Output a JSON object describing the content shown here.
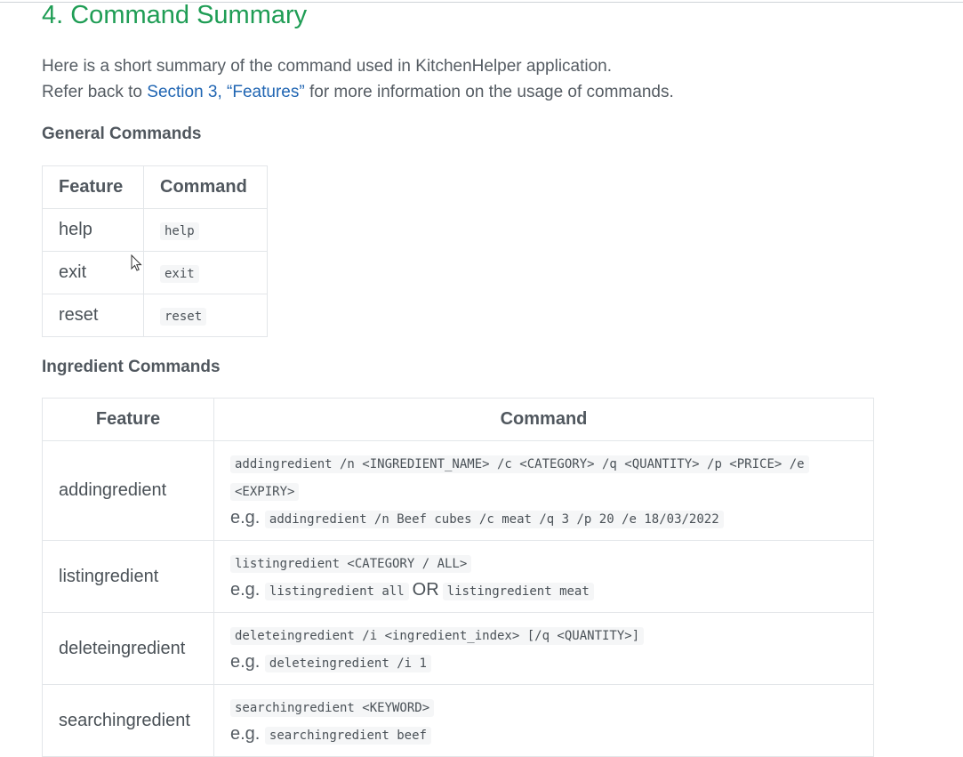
{
  "heading": "4. Command Summary",
  "intro": {
    "line1": "Here is a short summary of the command used in KitchenHelper application.",
    "line2_prefix": "Refer back to ",
    "link": "Section 3, “Features”",
    "line2_suffix": " for more information on the usage of commands."
  },
  "general": {
    "heading": "General Commands",
    "headers": {
      "feature": "Feature",
      "command": "Command"
    },
    "rows": [
      {
        "feature": "help",
        "command": "help"
      },
      {
        "feature": "exit",
        "command": "exit"
      },
      {
        "feature": "reset",
        "command": "reset"
      }
    ]
  },
  "ingredient": {
    "heading": "Ingredient Commands",
    "headers": {
      "feature": "Feature",
      "command": "Command"
    },
    "eg": "e.g.",
    "or": "OR",
    "rows": [
      {
        "feature": "addingredient",
        "syntax1": "addingredient /n <INGREDIENT_NAME> /c <CATEGORY> /q <QUANTITY> /p <PRICE> /e",
        "syntax2": "<EXPIRY>",
        "example": "addingredient /n Beef cubes /c meat /q 3 /p 20 /e 18/03/2022"
      },
      {
        "feature": "listingredient",
        "syntax1": "listingredient <CATEGORY / ALL>",
        "example": "listingredient all",
        "example2": "listingredient meat"
      },
      {
        "feature": "deleteingredient",
        "syntax1": "deleteingredient /i <ingredient_index> [/q <QUANTITY>]",
        "example": "deleteingredient /i 1"
      },
      {
        "feature": "searchingredient",
        "syntax1": "searchingredient <KEYWORD>",
        "example": "searchingredient beef"
      }
    ]
  }
}
